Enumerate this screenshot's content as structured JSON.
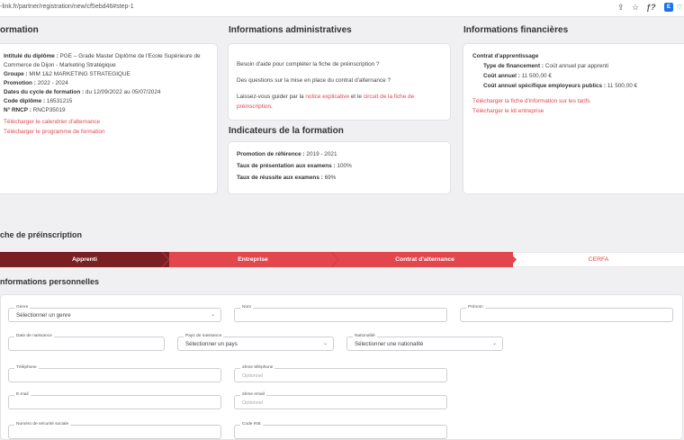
{
  "browser": {
    "url": "-link.fr/partner/registration/new/cf5ebd46#step-1",
    "share_icon": "⇪",
    "star_icon": "☆",
    "font_icon": "ƒ?",
    "ext_icon": "E"
  },
  "formation": {
    "title": "ormation",
    "diplome_label": "Intitulé du diplôme :",
    "diplome_value": " PGE – Grade Master Diplôme de l'Ecole Supérieure de",
    "diplome_value2": "Commerce de Dijon - Marketing Stratégique",
    "groupe_label": "Groupe :",
    "groupe_value": " MIM 1&2 MARKETING STRATEGIQUE",
    "promotion_label": "Promotion :",
    "promotion_value": " 2022 - 2024",
    "dates_label": "Dates du cycle de formation :",
    "dates_value": " du 12/09/2022 au 05/07/2024",
    "code_label": "Code diplôme :",
    "code_value": " 16531215",
    "rncp_label": "N° RNCP :",
    "rncp_value": " RNCP35019",
    "link_calendrier": "Télécharger le calendrier d'alternance",
    "link_programme": "Télécharger le programme de formation"
  },
  "admin": {
    "title": "Informations administratives",
    "help1": "Besoin d'aide pour compléter la fiche de préinscription ?",
    "help2": "Des questions sur la mise en place du contrat d'alternance ?",
    "guide_prefix": "Laissez-vous guider par la ",
    "guide_link1": "notice explicative",
    "guide_mid": " et le ",
    "guide_link2": "circuit de la fiche de",
    "guide_link2b": "préinscription",
    "guide_end": "."
  },
  "indicateurs": {
    "title": "Indicateurs de la formation",
    "promo_label": "Promotion de référence :",
    "promo_value": " 2019 - 2021",
    "presentation_label": "Taux de présentation aux examens :",
    "presentation_value": " 100%",
    "reussite_label": "Taux de réussite aux examens :",
    "reussite_value": " 69%"
  },
  "finance": {
    "title": "Informations financières",
    "contrat_label": "Contrat d'apprentissage",
    "type_label": "Type de financement :",
    "type_value": " Coût annuel par apprenti",
    "cout_label": "Coût annuel :",
    "cout_value": " 11 500,00 €",
    "cout_pub_label": "Coût annuel spécifique employeurs publics :",
    "cout_pub_value": " 11 500,00 €",
    "link_tarifs": "Télécharger la fiche d'information sur les tarifs",
    "link_kit": "Télécharger le kit entreprise"
  },
  "fiche": {
    "title": "che de préinscription",
    "steps": [
      "Apprenti",
      "Entreprise",
      "Contrat d'alternance",
      "CERFA"
    ]
  },
  "perso": {
    "title": "nformations personnelles",
    "genre_label": "Genre",
    "genre_value": "Sélectionner un genre",
    "nom_label": "Nom",
    "prenom_label": "Prénom",
    "naissance_label": "Date de naissance",
    "pays_label": "Pays de naissance",
    "pays_value": "Sélectionner un pays",
    "nationalite_label": "Nationalité",
    "nationalite_value": "Sélectionner une nationalité",
    "tel_label": "Téléphone",
    "tel2_label": "2ème téléphone",
    "tel2_ph": "Optionnel",
    "email_label": "E-mail",
    "email2_label": "2ème email",
    "email2_ph": "Optionnel",
    "secu_label": "Numéro de sécurité sociale",
    "ine_label": "Code INE"
  },
  "colors": {
    "accent": "#e2474e",
    "past_step": "#7a1f22"
  }
}
